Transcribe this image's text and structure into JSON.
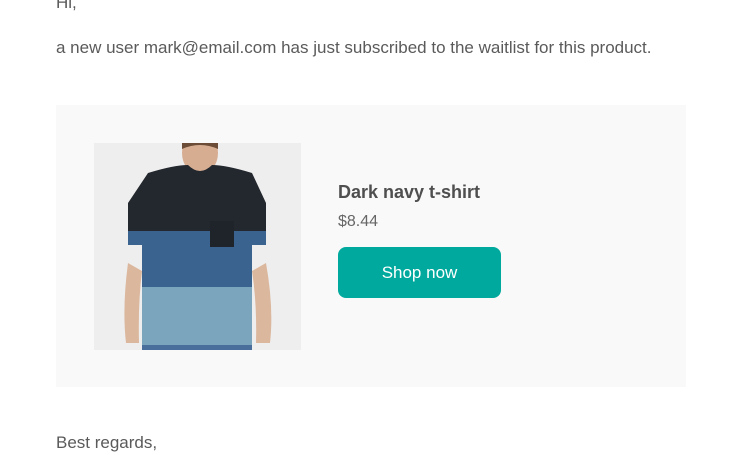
{
  "email": {
    "greeting": "Hi,",
    "message": "a new user mark@email.com has just subscribed to the waitlist for this product.",
    "closing": "Best regards,"
  },
  "product": {
    "name": "Dark navy t-shirt",
    "price": "$8.44",
    "button_label": "Shop now",
    "image_alt": "Dark navy t-shirt"
  },
  "colors": {
    "button": "#00a99d",
    "card_background": "#f9f9f9",
    "text": "#5a5a5a"
  }
}
